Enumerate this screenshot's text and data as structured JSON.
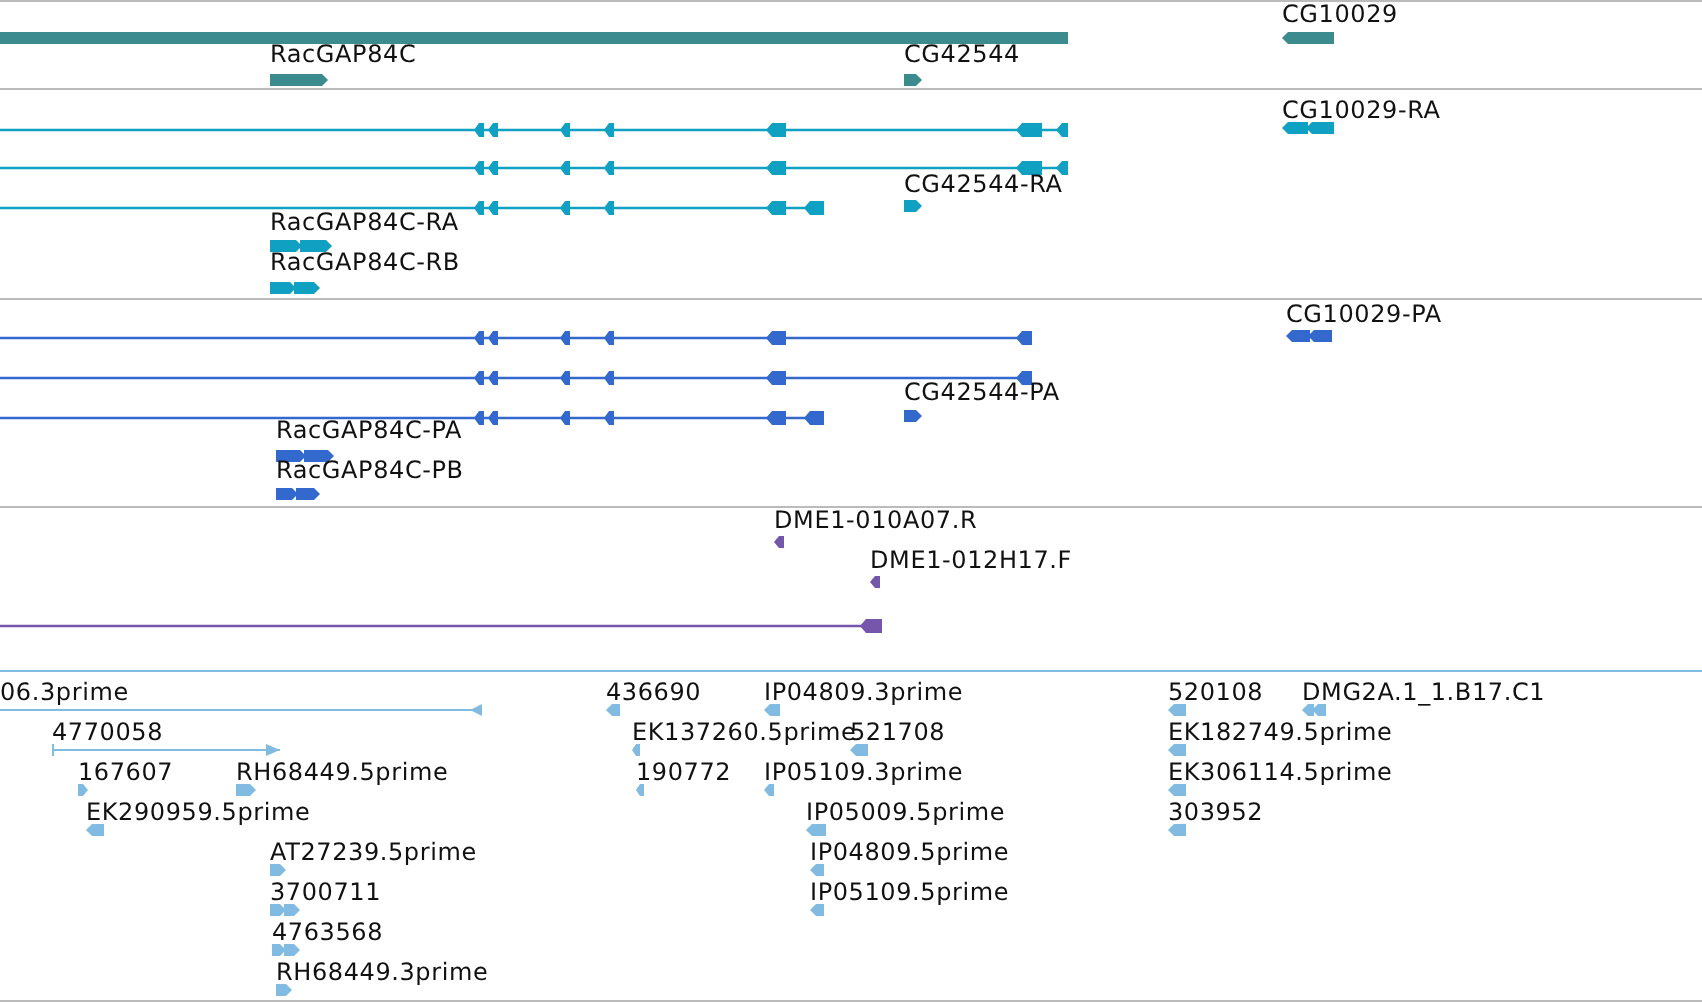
{
  "tracks": [
    {
      "color": "#3b8b8f",
      "features": [
        {
          "kind": "plain"
        },
        {
          "label": "RacGAP84C",
          "kind": "forward"
        },
        {
          "label": "CG42544",
          "kind": "forward"
        },
        {
          "label": "CG10029",
          "kind": "reverse"
        }
      ]
    },
    {
      "color": "#0fa0c2",
      "features": [
        {
          "label": "CG10029-RA",
          "kind": "reverse"
        },
        {
          "kind": "reverse"
        },
        {
          "kind": "reverse"
        },
        {
          "label": "CG42544-RA",
          "kind": "forward"
        },
        {
          "kind": "reverse"
        },
        {
          "label": "RacGAP84C-RA",
          "kind": "forward"
        },
        {
          "label": "RacGAP84C-RB",
          "kind": "forward"
        }
      ]
    },
    {
      "color": "#3369cc",
      "features": [
        {
          "label": "CG10029-PA",
          "kind": "reverse"
        },
        {
          "kind": "reverse"
        },
        {
          "kind": "reverse"
        },
        {
          "label": "CG42544-PA",
          "kind": "forward"
        },
        {
          "kind": "reverse"
        },
        {
          "label": "RacGAP84C-PA",
          "kind": "forward"
        },
        {
          "label": "RacGAP84C-PB",
          "kind": "forward"
        }
      ]
    },
    {
      "color": "#7655ad",
      "features": [
        {
          "label": "DME1-010A07.R",
          "kind": "reverse"
        },
        {
          "label": "DME1-012H17.F",
          "kind": "reverse"
        },
        {
          "kind": "reverse"
        }
      ]
    },
    {
      "color": "#82bbe2",
      "features": [
        {
          "label": "06.3prime",
          "kind": "reverse"
        },
        {
          "label": "436690",
          "kind": "reverse"
        },
        {
          "label": "IP04809.3prime",
          "kind": "reverse"
        },
        {
          "label": "520108",
          "kind": "reverse"
        },
        {
          "label": "DMG2A.1_1.B17.C1",
          "kind": "reverse"
        },
        {
          "label": "4770058",
          "kind": "forward"
        },
        {
          "label": "EK137260.5prime",
          "kind": "reverse"
        },
        {
          "label": "521708",
          "kind": "reverse"
        },
        {
          "label": "EK182749.5prime",
          "kind": "reverse"
        },
        {
          "label": "167607",
          "kind": "forward"
        },
        {
          "label": "RH68449.5prime",
          "kind": "forward"
        },
        {
          "label": "190772",
          "kind": "reverse"
        },
        {
          "label": "IP05109.3prime",
          "kind": "reverse"
        },
        {
          "label": "EK306114.5prime",
          "kind": "reverse"
        },
        {
          "label": "EK290959.5prime",
          "kind": "reverse"
        },
        {
          "label": "IP05009.5prime",
          "kind": "reverse"
        },
        {
          "label": "303952",
          "kind": "reverse"
        },
        {
          "label": "AT27239.5prime",
          "kind": "forward"
        },
        {
          "label": "IP04809.5prime",
          "kind": "reverse"
        },
        {
          "label": "3700711",
          "kind": "forward"
        },
        {
          "label": "IP05109.5prime",
          "kind": "reverse"
        },
        {
          "label": "4763568",
          "kind": "forward"
        },
        {
          "label": "RH68449.3prime",
          "kind": "forward"
        }
      ]
    }
  ]
}
